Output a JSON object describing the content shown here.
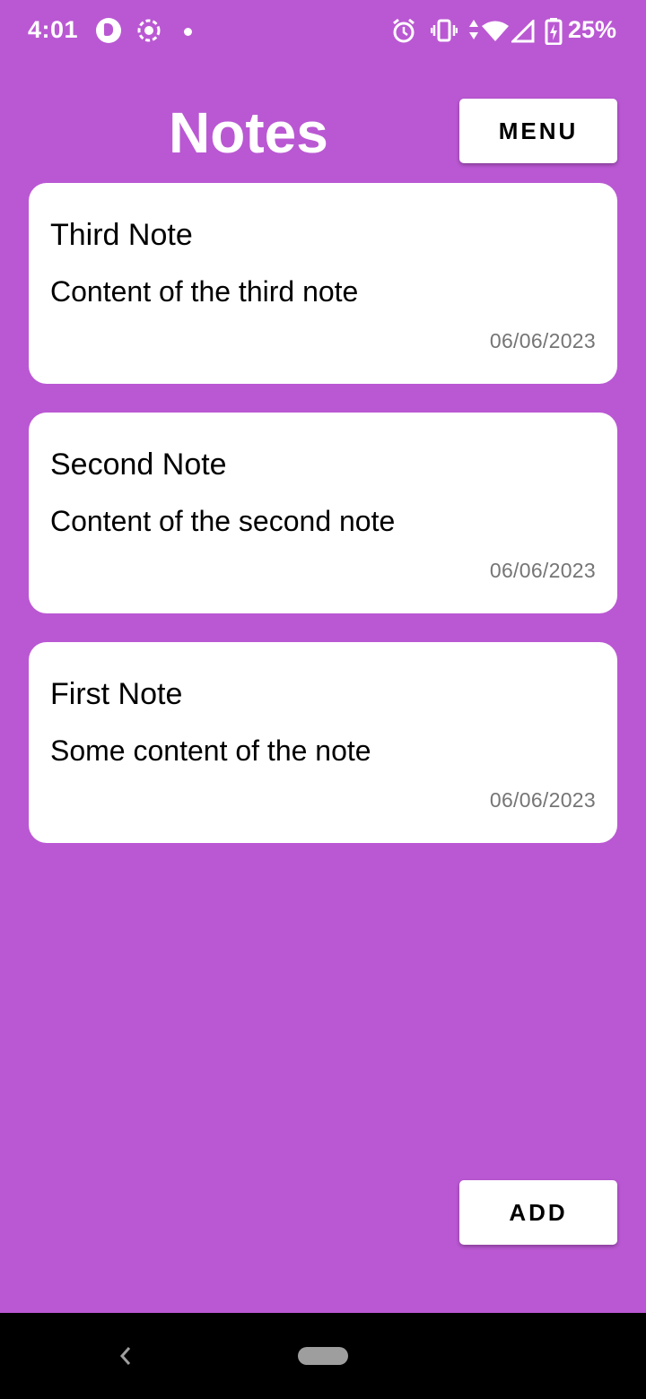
{
  "status_bar": {
    "time": "4:01",
    "battery_percent": "25%",
    "icons": [
      "app-p-icon",
      "screen-record-icon",
      "dot-icon",
      "alarm-icon",
      "vibrate-icon",
      "data-arrows-icon",
      "wifi-icon",
      "signal-icon",
      "battery-charging-icon"
    ]
  },
  "header": {
    "title": "Notes",
    "menu_label": "MENU"
  },
  "notes": [
    {
      "title": "Third Note",
      "content": "Content of the third note",
      "date": "06/06/2023"
    },
    {
      "title": "Second Note",
      "content": "Content of the second note",
      "date": "06/06/2023"
    },
    {
      "title": "First Note",
      "content": "Some content of the note",
      "date": "06/06/2023"
    }
  ],
  "footer": {
    "add_label": "ADD"
  },
  "nav_bar": {
    "icons": [
      "back-icon",
      "home-pill-icon"
    ]
  },
  "colors": {
    "background": "#BA58D3",
    "card": "#FFFFFF",
    "date_text": "#757575"
  }
}
